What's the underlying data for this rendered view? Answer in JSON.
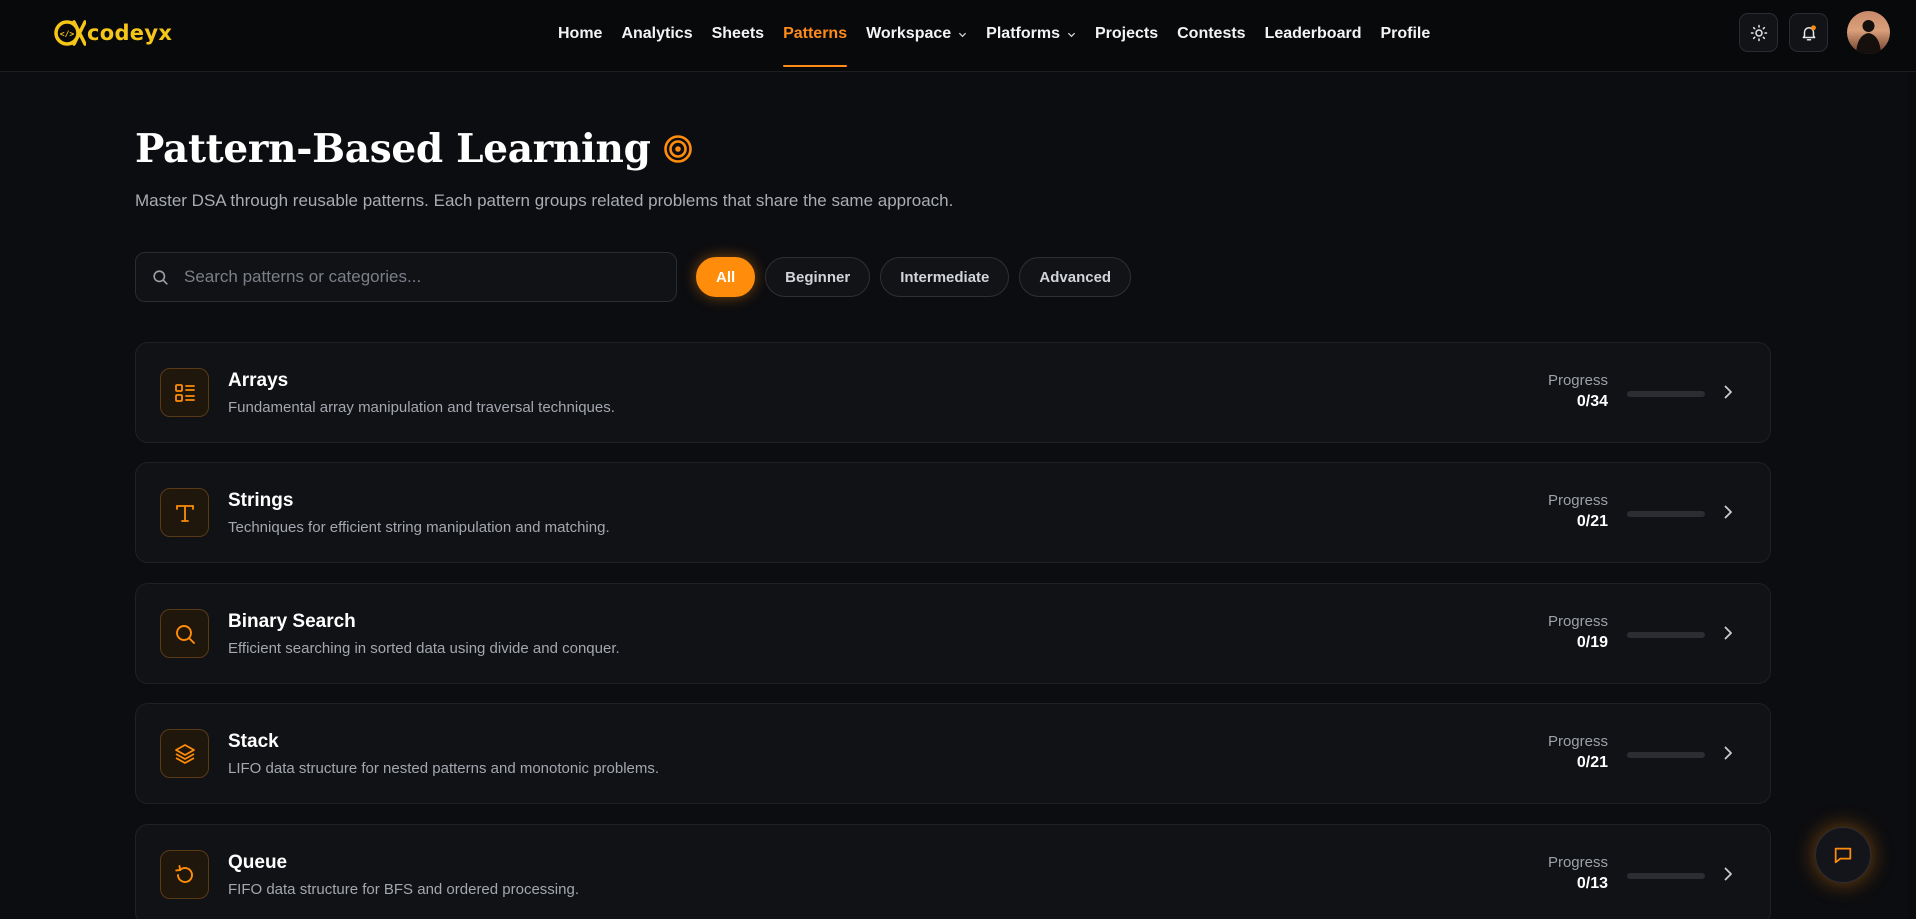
{
  "brand": {
    "name": "codeyx",
    "mark": "</>"
  },
  "nav": {
    "items": [
      {
        "label": "Home",
        "active": false,
        "dropdown": false
      },
      {
        "label": "Analytics",
        "active": false,
        "dropdown": false
      },
      {
        "label": "Sheets",
        "active": false,
        "dropdown": false
      },
      {
        "label": "Patterns",
        "active": true,
        "dropdown": false
      },
      {
        "label": "Workspace",
        "active": false,
        "dropdown": true
      },
      {
        "label": "Platforms",
        "active": false,
        "dropdown": true
      },
      {
        "label": "Projects",
        "active": false,
        "dropdown": false
      },
      {
        "label": "Contests",
        "active": false,
        "dropdown": false
      },
      {
        "label": "Leaderboard",
        "active": false,
        "dropdown": false
      },
      {
        "label": "Profile",
        "active": false,
        "dropdown": false
      }
    ],
    "icons": [
      "sun-icon",
      "bell-icon",
      "avatar"
    ]
  },
  "page": {
    "title": "Pattern-Based Learning",
    "subtitle": "Master DSA through reusable patterns. Each pattern groups related problems that share the same approach."
  },
  "search": {
    "placeholder": "Search patterns or categories...",
    "value": ""
  },
  "filters": [
    {
      "label": "All",
      "active": true
    },
    {
      "label": "Beginner",
      "active": false
    },
    {
      "label": "Intermediate",
      "active": false
    },
    {
      "label": "Advanced",
      "active": false
    }
  ],
  "patterns": [
    {
      "title": "Arrays",
      "description": "Fundamental array manipulation and traversal techniques.",
      "progress_label": "Progress",
      "progress": "0/34",
      "solved": 0,
      "total": 34,
      "icon": "list-icon"
    },
    {
      "title": "Strings",
      "description": "Techniques for efficient string manipulation and matching.",
      "progress_label": "Progress",
      "progress": "0/21",
      "solved": 0,
      "total": 21,
      "icon": "text-icon"
    },
    {
      "title": "Binary Search",
      "description": "Efficient searching in sorted data using divide and conquer.",
      "progress_label": "Progress",
      "progress": "0/19",
      "solved": 0,
      "total": 19,
      "icon": "search-icon"
    },
    {
      "title": "Stack",
      "description": "LIFO data structure for nested patterns and monotonic problems.",
      "progress_label": "Progress",
      "progress": "0/21",
      "solved": 0,
      "total": 21,
      "icon": "layers-icon"
    },
    {
      "title": "Queue",
      "description": "FIFO data structure for BFS and ordered processing.",
      "progress_label": "Progress",
      "progress": "0/13",
      "solved": 0,
      "total": 13,
      "icon": "rotate-icon"
    }
  ],
  "colors": {
    "accent": "#ff8c0a",
    "background": "#0c0d10",
    "card": "#111216",
    "logo": "#f5c518"
  }
}
